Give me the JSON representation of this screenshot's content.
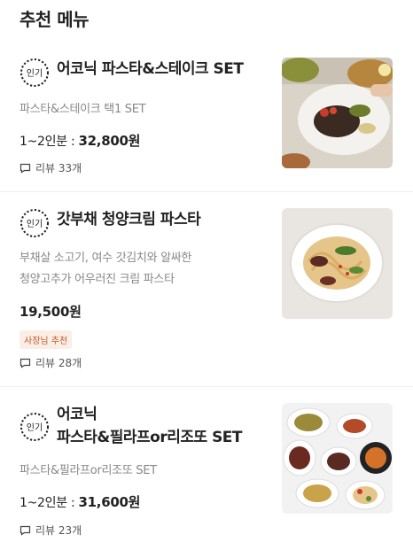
{
  "header": {
    "title": "추천 메뉴"
  },
  "items": [
    {
      "badge": "인기",
      "name_lines": [
        "어코닉 파스타&스테이크 SET"
      ],
      "desc_lines": [
        "파스타&스테이크 택1 SET"
      ],
      "price_prefix": "1~2인분 : ",
      "price": "32,800원",
      "tag": "",
      "review": "리뷰 33개",
      "image_icon": "steak-pasta-plate-photo"
    },
    {
      "badge": "인기",
      "name_lines": [
        "갓부채 청양크림 파스타"
      ],
      "desc_lines": [
        "부채살 소고기, 여수 갓김치와 알싸한",
        "청양고추가 어우러진 크림 파스타"
      ],
      "price_prefix": "",
      "price": "19,500원",
      "tag": "사장님 추천",
      "review": "리뷰 28개",
      "image_icon": "cream-pasta-photo"
    },
    {
      "badge": "인기",
      "name_lines": [
        "어코닉",
        "파스타&필라프or리조또 SET"
      ],
      "desc_lines": [
        "파스타&필라프or리조또 SET"
      ],
      "price_prefix": "1~2인분 : ",
      "price": "31,600원",
      "tag": "",
      "review": "리뷰 23개",
      "image_icon": "set-table-spread-photo"
    }
  ],
  "colors": {
    "tag_bg": "#fbeee6",
    "tag_text": "#c55a2a",
    "desc": "#888888"
  }
}
